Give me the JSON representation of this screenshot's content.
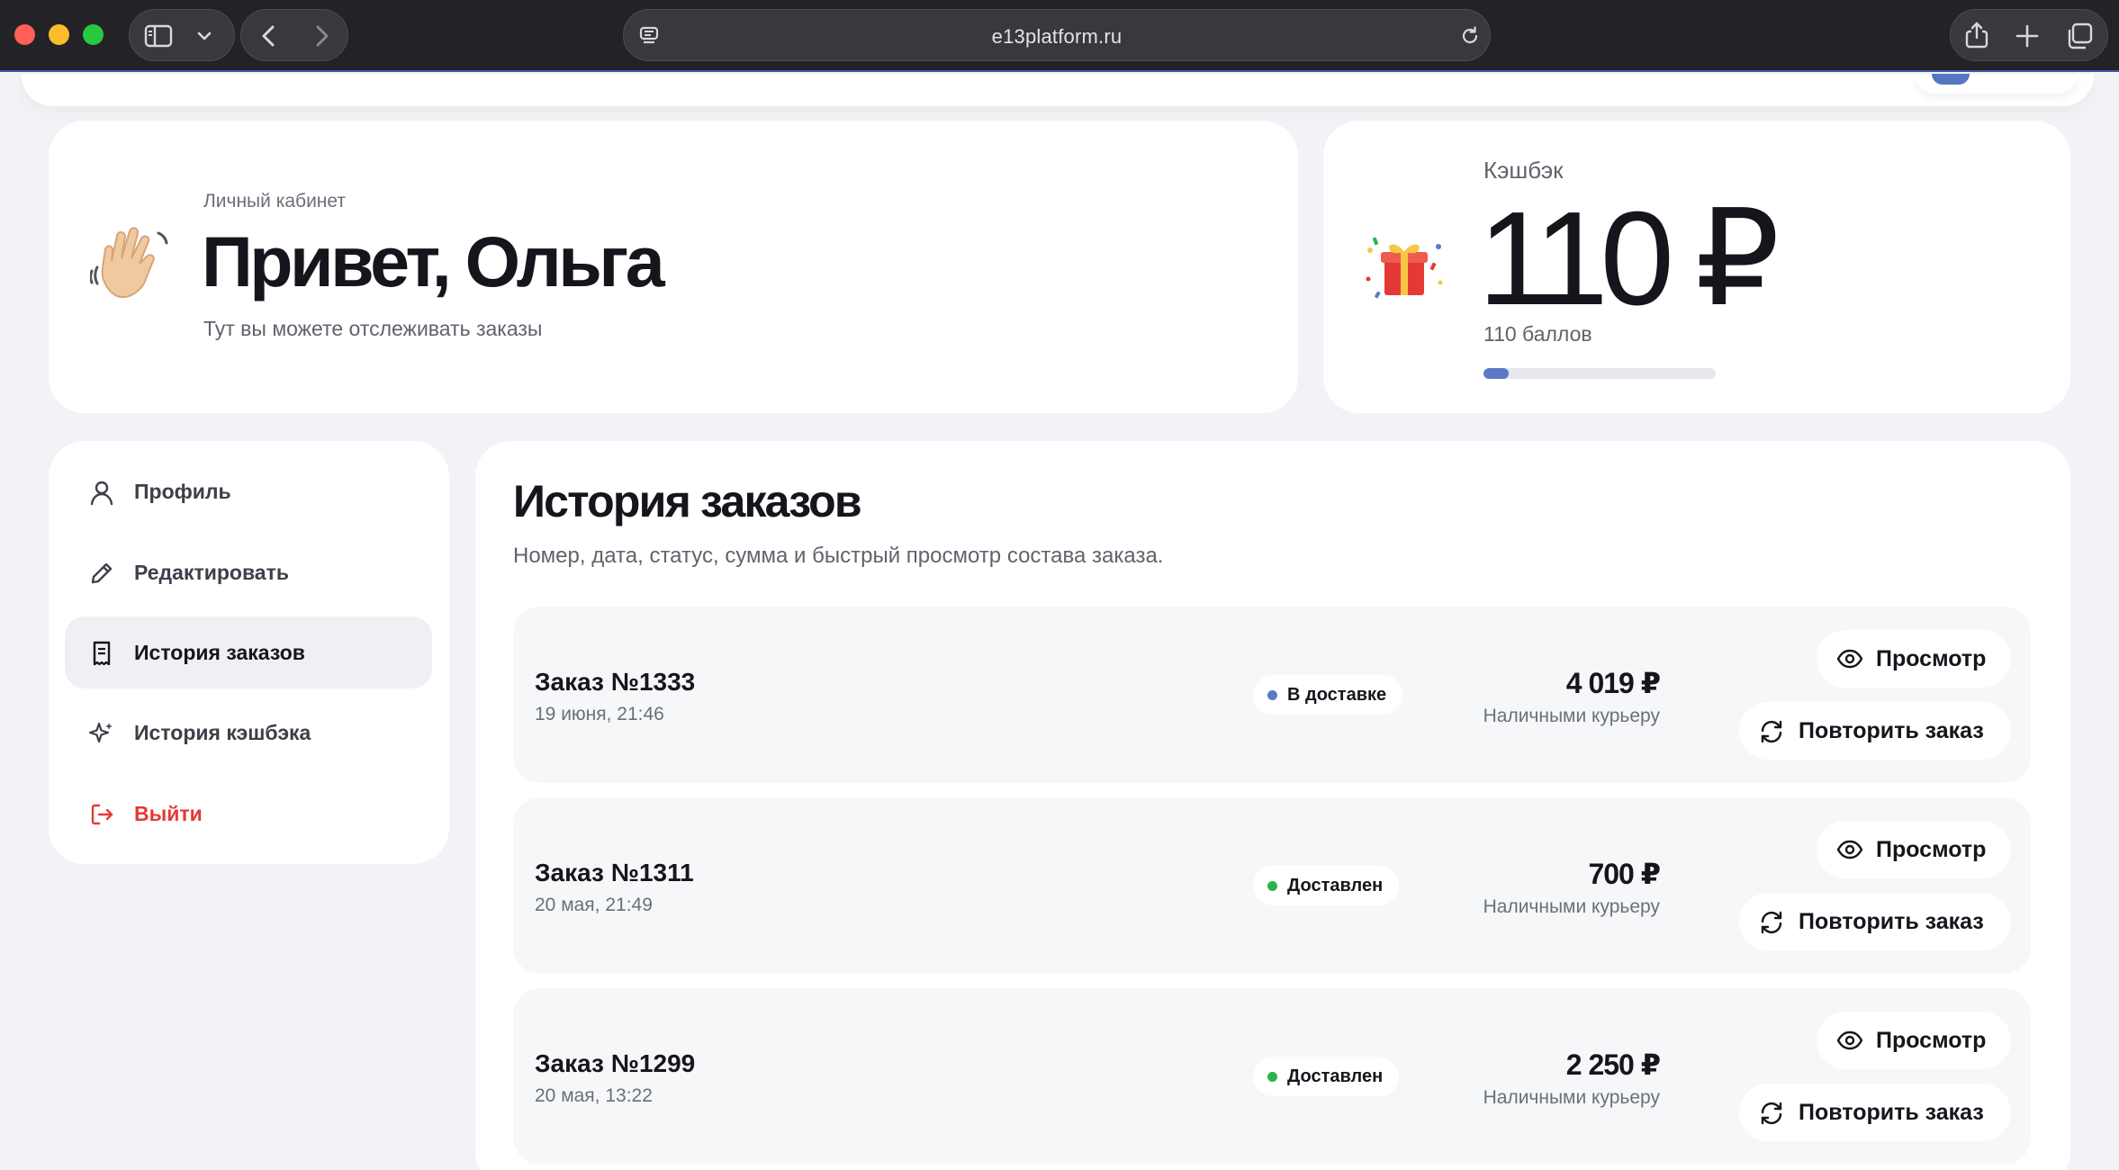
{
  "browser": {
    "url": "e13platform.ru"
  },
  "greeting": {
    "eyebrow": "Личный кабинет",
    "title": "Привет, Ольга",
    "subtitle": "Тут вы можете отслеживать заказы"
  },
  "cashback": {
    "label": "Кэшбэк",
    "amount": "110 ₽",
    "points": "110 баллов",
    "progress_fraction": 0.11
  },
  "sidebar": {
    "items": [
      {
        "label": "Профиль",
        "icon": "user-icon"
      },
      {
        "label": "Редактировать",
        "icon": "pencil-icon"
      },
      {
        "label": "История заказов",
        "icon": "receipt-icon",
        "active": true
      },
      {
        "label": "История кэшбэка",
        "icon": "sparkle-icon"
      },
      {
        "label": "Выйти",
        "icon": "logout-icon"
      }
    ]
  },
  "orders": {
    "title": "История заказов",
    "subtitle": "Номер, дата, статус, сумма и быстрый просмотр состава заказа.",
    "view_label": "Просмотр",
    "repeat_label": "Повторить заказ",
    "items": [
      {
        "number": "Заказ №1333",
        "date": "19 июня, 21:46",
        "status": "В доставке",
        "status_color": "#5b79c4",
        "price": "4 019 ₽",
        "payment": "Наличными курьеру"
      },
      {
        "number": "Заказ №1311",
        "date": "20 мая, 21:49",
        "status": "Доставлен",
        "status_color": "#2bb24c",
        "price": "700 ₽",
        "payment": "Наличными курьеру"
      },
      {
        "number": "Заказ №1299",
        "date": "20 мая, 13:22",
        "status": "Доставлен",
        "status_color": "#2bb24c",
        "price": "2 250 ₽",
        "payment": "Наличными курьеру"
      }
    ]
  },
  "colors": {
    "accent": "#5b79c4",
    "danger": "#e53935",
    "success": "#2bb24c",
    "page_bg": "#f2f3f6"
  }
}
